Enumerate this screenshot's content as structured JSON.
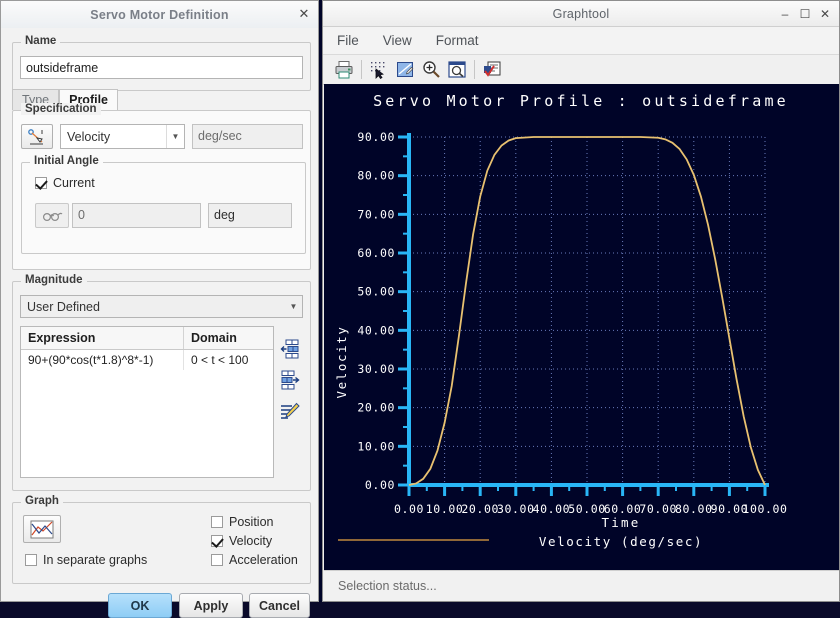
{
  "dialog": {
    "title": "Servo Motor Definition",
    "close_icon": "close-icon",
    "name_group_label": "Name",
    "name_value": "outsideframe",
    "tabs": [
      {
        "label": "Type",
        "active": false
      },
      {
        "label": "Profile",
        "active": true
      }
    ],
    "specification": {
      "group_label": "Specification",
      "icon": "motion-profile-icon",
      "quantity": "Velocity",
      "units": "deg/sec",
      "initial_angle": {
        "group_label": "Initial Angle",
        "current_label": "Current",
        "current_checked": true,
        "pick_icon": "select-point-icon",
        "value": "0",
        "units": "deg"
      }
    },
    "magnitude": {
      "group_label": "Magnitude",
      "mode": "User Defined",
      "columns": [
        "Expression",
        "Domain"
      ],
      "rows": [
        {
          "expression": "90+(90*cos(t*1.8)^8*-1)",
          "domain": "0 < t < 100"
        }
      ],
      "side_buttons": [
        "insert-row-before-icon",
        "insert-row-after-icon",
        "edit-expression-icon"
      ]
    },
    "graph": {
      "group_label": "Graph",
      "plot_icon": "plot-graph-icon",
      "separate_graphs_label": "In separate graphs",
      "separate_graphs_checked": false,
      "options": [
        {
          "label": "Position",
          "checked": false
        },
        {
          "label": "Velocity",
          "checked": true
        },
        {
          "label": "Acceleration",
          "checked": false
        }
      ]
    },
    "buttons": {
      "ok": "OK",
      "apply": "Apply",
      "cancel": "Cancel"
    }
  },
  "graphtool": {
    "title": "Graphtool",
    "window_controls": [
      "minimize-icon",
      "maximize-icon",
      "close-icon"
    ],
    "menu": [
      "File",
      "View",
      "Format"
    ],
    "toolbar": [
      "print-icon",
      "point-select-icon",
      "edit-graph-icon",
      "zoom-in-icon",
      "zoom-window-icon",
      "report-icon"
    ],
    "status": "Selection status..."
  },
  "chart_data": {
    "type": "line",
    "title": "Servo Motor Profile : outsideframe",
    "xlabel": "Time",
    "ylabel": "Velocity",
    "xlim": [
      0,
      100
    ],
    "ylim": [
      0,
      90
    ],
    "xticks": [
      "0.00",
      "10.00",
      "20.00",
      "30.00",
      "40.00",
      "50.00",
      "60.00",
      "70.00",
      "80.00",
      "90.00",
      "100.00"
    ],
    "yticks": [
      "0.00",
      "10.00",
      "20.00",
      "30.00",
      "40.00",
      "50.00",
      "60.00",
      "70.00",
      "80.00",
      "90.00"
    ],
    "xtick_values": [
      0,
      10,
      20,
      30,
      40,
      50,
      60,
      70,
      80,
      90,
      100
    ],
    "ytick_values": [
      0,
      10,
      20,
      30,
      40,
      50,
      60,
      70,
      80,
      90
    ],
    "minor_tick_step_x": 5,
    "minor_tick_step_y": 5,
    "grid": true,
    "grid_style": "dotted",
    "legend": [
      {
        "name": "Velocity (deg/sec)",
        "color": "#e8c170"
      }
    ],
    "legend_position": "bottom",
    "background_color": "#000428",
    "axis_color": "#29b6f6",
    "grid_color": "#7b8fd4",
    "text_color": "#ffffff",
    "series": [
      {
        "name": "Velocity (deg/sec)",
        "color": "#e8c170",
        "expression": "90+(90*cos(t*1.8)^8*-1)",
        "x": [
          0,
          2,
          4,
          6,
          8,
          10,
          12,
          14,
          16,
          18,
          20,
          22,
          24,
          26,
          28,
          30,
          35,
          40,
          45,
          50,
          55,
          60,
          65,
          70,
          72,
          74,
          76,
          78,
          80,
          82,
          84,
          86,
          88,
          90,
          92,
          94,
          96,
          98,
          100
        ],
        "y": [
          0,
          0.4,
          1.6,
          4.2,
          8.9,
          16.1,
          25.6,
          38.4,
          52.1,
          64.8,
          74.6,
          81.3,
          85.4,
          87.8,
          89.1,
          89.7,
          90,
          90,
          90,
          90,
          90,
          90,
          90,
          89.8,
          89.4,
          88.5,
          86.9,
          84.2,
          80.2,
          74.6,
          67.3,
          58.4,
          48.4,
          37.9,
          27.4,
          17.8,
          9.8,
          3.9,
          0
        ]
      }
    ]
  }
}
